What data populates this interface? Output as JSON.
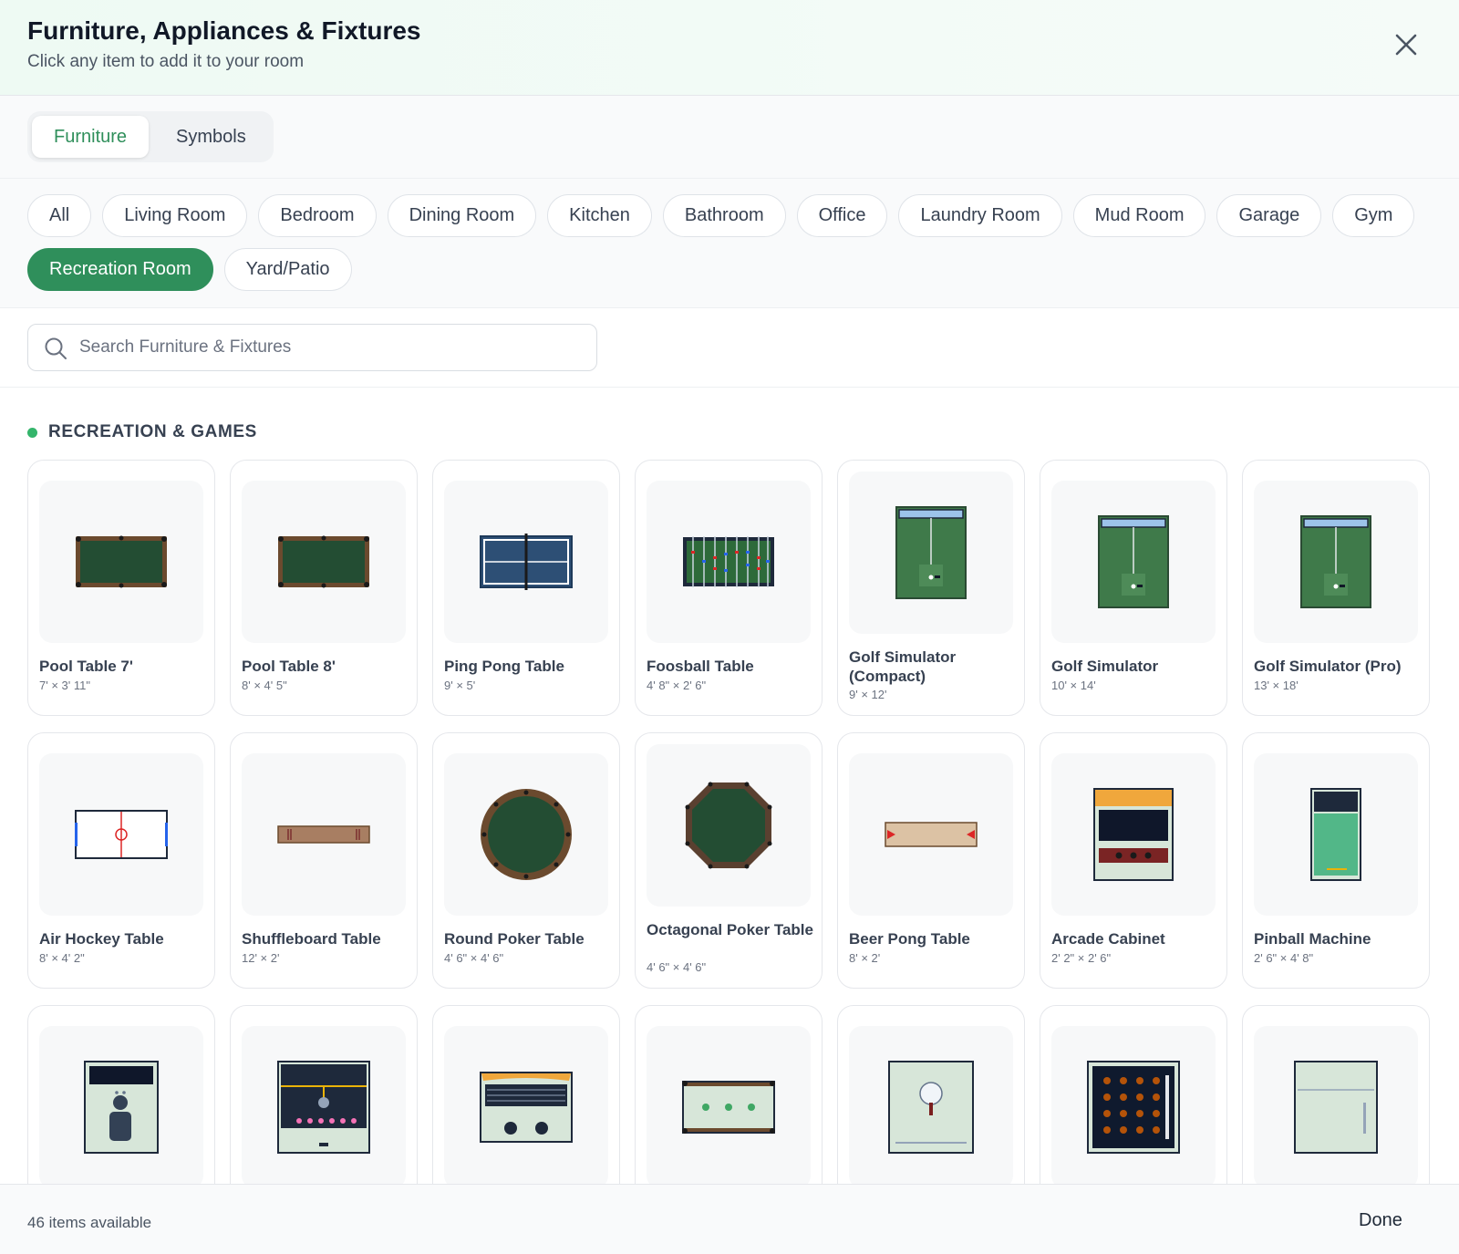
{
  "header": {
    "title": "Furniture, Appliances & Fixtures",
    "subtitle": "Click any item to add it to your room",
    "close_icon": "close-icon"
  },
  "tabs": [
    {
      "label": "Furniture",
      "active": true
    },
    {
      "label": "Symbols",
      "active": false
    }
  ],
  "categories": [
    {
      "label": "All"
    },
    {
      "label": "Living Room"
    },
    {
      "label": "Bedroom"
    },
    {
      "label": "Dining Room"
    },
    {
      "label": "Kitchen"
    },
    {
      "label": "Bathroom"
    },
    {
      "label": "Office"
    },
    {
      "label": "Laundry Room"
    },
    {
      "label": "Mud Room"
    },
    {
      "label": "Garage"
    },
    {
      "label": "Gym"
    },
    {
      "label": "Recreation Room",
      "active": true
    },
    {
      "label": "Yard/Patio"
    }
  ],
  "search": {
    "placeholder": "Search Furniture & Fixtures",
    "value": "",
    "icon": "search-icon"
  },
  "section": {
    "label": "RECREATION & GAMES",
    "dot_color": "#34b56b"
  },
  "items": [
    {
      "name": "Pool Table 7'",
      "dims": "7' × 3' 11\"",
      "icon": "pool-table-icon"
    },
    {
      "name": "Pool Table 8'",
      "dims": "8' × 4' 5\"",
      "icon": "pool-table-icon"
    },
    {
      "name": "Ping Pong Table",
      "dims": "9' × 5'",
      "icon": "ping-pong-table-icon"
    },
    {
      "name": "Foosball Table",
      "dims": "4' 8\" × 2' 6\"",
      "icon": "foosball-table-icon"
    },
    {
      "name": "Golf Simulator (Compact)",
      "dims": "9' × 12'",
      "icon": "golf-simulator-icon"
    },
    {
      "name": "Golf Simulator",
      "dims": "10' × 14'",
      "icon": "golf-simulator-icon"
    },
    {
      "name": "Golf Simulator (Pro)",
      "dims": "13' × 18'",
      "icon": "golf-simulator-icon"
    },
    {
      "name": "Air Hockey Table",
      "dims": "8' × 4' 2\"",
      "icon": "air-hockey-table-icon"
    },
    {
      "name": "Shuffleboard Table",
      "dims": "12' × 2'",
      "icon": "shuffleboard-table-icon"
    },
    {
      "name": "Round Poker Table",
      "dims": "4' 6\" × 4' 6\"",
      "icon": "round-poker-table-icon"
    },
    {
      "name": "Octagonal Poker Table",
      "dims": "4' 6\" × 4' 6\"",
      "icon": "octagonal-poker-table-icon"
    },
    {
      "name": "Beer Pong Table",
      "dims": "8' × 2'",
      "icon": "beer-pong-table-icon"
    },
    {
      "name": "Arcade Cabinet",
      "dims": "2' 2\" × 2' 6\"",
      "icon": "arcade-cabinet-icon"
    },
    {
      "name": "Pinball Machine",
      "dims": "2' 6\" × 4' 8\"",
      "icon": "pinball-machine-icon"
    },
    {
      "name": "",
      "dims": "",
      "icon": "claw-machine-icon"
    },
    {
      "name": "",
      "dims": "",
      "icon": "skee-ball-icon"
    },
    {
      "name": "",
      "dims": "",
      "icon": "jukebox-icon"
    },
    {
      "name": "",
      "dims": "",
      "icon": "bumper-pool-table-icon"
    },
    {
      "name": "",
      "dims": "",
      "icon": "putting-green-icon"
    },
    {
      "name": "",
      "dims": "",
      "icon": "dartboard-cabinet-icon"
    },
    {
      "name": "",
      "dims": "",
      "icon": "card-table-icon"
    }
  ],
  "footer": {
    "count": "46 items available",
    "done_label": "Done"
  },
  "colors": {
    "accent": "#2f8f5b",
    "felt_green": "#234d33",
    "wood_brown": "#6b4a2e"
  }
}
